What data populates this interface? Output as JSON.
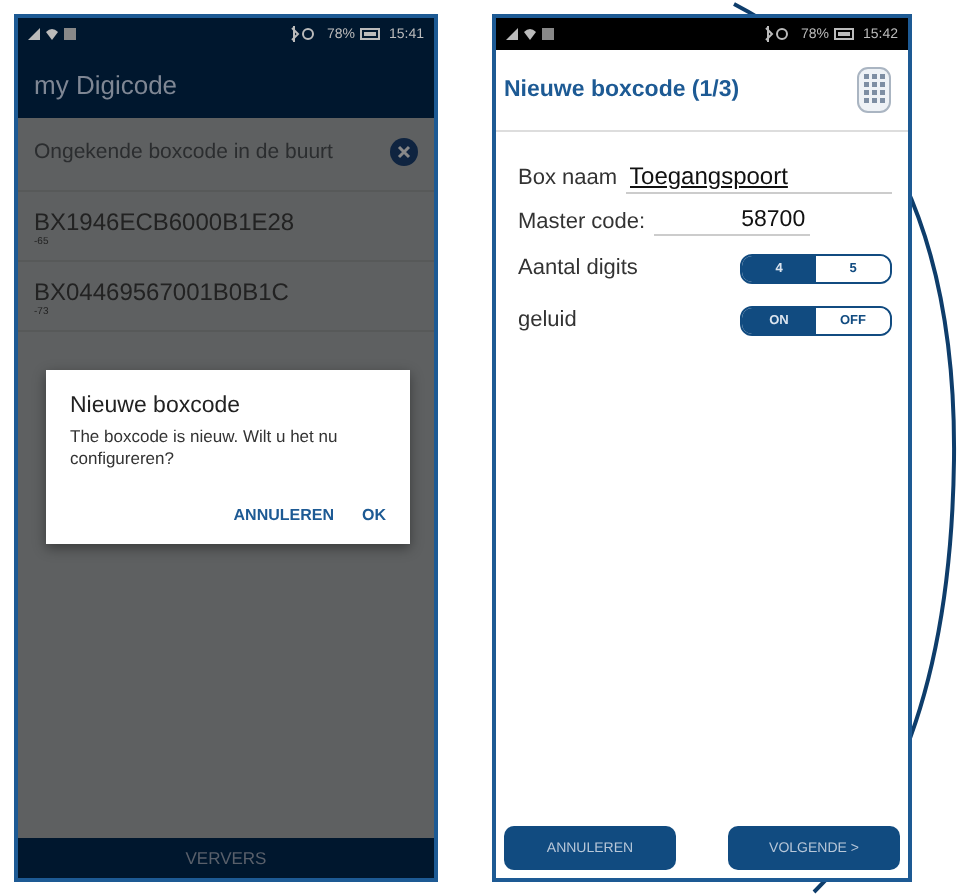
{
  "left_phone": {
    "status_bar": {
      "battery": "78%",
      "time": "15:41"
    },
    "app_title": "my Digicode",
    "banner": {
      "text": "Ongekende boxcode in de buurt"
    },
    "devices": [
      {
        "name": "BX1946ECB6000B1E28",
        "rssi": "-65"
      },
      {
        "name": "BX04469567001B0B1C",
        "rssi": "-73"
      }
    ],
    "dialog": {
      "title": "Nieuwe boxcode",
      "message": "The boxcode is nieuw. Wilt u het nu configureren?",
      "buttons": [
        "ANNULEREN",
        "OK"
      ]
    },
    "bottom_button": "VERVERS"
  },
  "right_phone": {
    "status_bar": {
      "battery": "78%",
      "time": "15:42"
    },
    "title": "Nieuwe boxcode (1/3)",
    "fields": [
      {
        "label": "Box naam",
        "value": "Toegangspoort"
      },
      {
        "label": "Master code:",
        "value": "58700"
      }
    ],
    "toggles": [
      {
        "label": "Aantal digits",
        "options": [
          {
            "label": "4",
            "selected": true
          },
          {
            "label": "5",
            "selected": false
          }
        ]
      },
      {
        "label": "geluid",
        "options": [
          {
            "label": "ON",
            "selected": true
          },
          {
            "label": "OFF",
            "selected": false
          }
        ]
      }
    ],
    "buttons": [
      "ANNULEREN",
      "VOLGENDE >"
    ]
  }
}
